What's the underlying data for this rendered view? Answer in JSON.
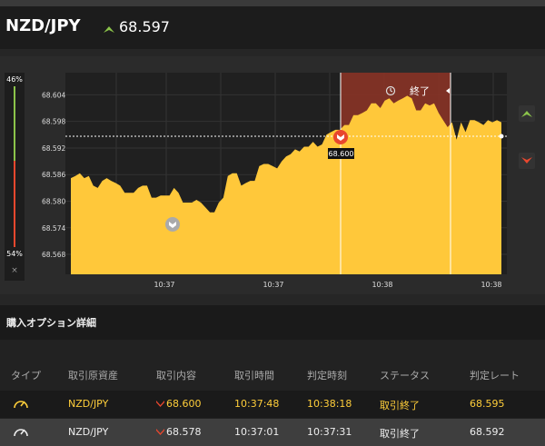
{
  "header": {
    "pair": "NZD/JPY",
    "rate": "68.597",
    "rate_direction_icon": "up-arrow-icon",
    "accent_up": "#8bc34a",
    "accent_down": "#e8472e"
  },
  "gauge": {
    "top_label": "46%",
    "bottom_label": "54%",
    "close_label": "×",
    "up_percent": 46,
    "down_percent": 54
  },
  "chart": {
    "y_ticks": [
      "68.604",
      "68.598",
      "68.592",
      "68.586",
      "68.580",
      "68.574",
      "68.568"
    ],
    "x_ticks": [
      "10:37",
      "10:37",
      "10:38",
      "10:38"
    ],
    "current_rate": 68.597,
    "entry_marker_label": "68.600",
    "expiry_label": "終了",
    "area_color": "#ffc83a"
  },
  "chart_data": {
    "type": "area",
    "ylim": [
      68.5635,
      68.609
    ],
    "y": [
      68.5852,
      68.5857,
      68.5863,
      68.5852,
      68.5857,
      68.5835,
      68.583,
      68.5846,
      68.5852,
      68.5846,
      68.5841,
      68.5835,
      68.5819,
      68.5819,
      68.5819,
      68.583,
      68.5835,
      68.5835,
      68.5808,
      68.5808,
      68.5813,
      68.5813,
      68.5813,
      68.583,
      68.5819,
      68.5797,
      68.5797,
      68.5797,
      68.5803,
      68.5797,
      68.5786,
      68.5775,
      68.5775,
      68.5797,
      68.5808,
      68.5857,
      68.5863,
      68.5863,
      68.5835,
      68.5841,
      68.5846,
      68.5846,
      68.5879,
      68.5884,
      68.5884,
      68.5879,
      68.5874,
      68.589,
      68.5901,
      68.5906,
      68.5917,
      68.5912,
      68.5923,
      68.5923,
      68.5934,
      68.5923,
      68.5928,
      68.595,
      68.5956,
      68.5961,
      68.5961,
      68.5972,
      68.5972,
      68.5994,
      68.5994,
      68.5999,
      68.6005,
      68.6021,
      68.6021,
      68.601,
      68.6027,
      68.6032,
      68.6021,
      68.6027,
      68.6032,
      68.6038,
      68.6032,
      68.6005,
      68.6005,
      68.6021,
      68.6016,
      68.6021,
      68.5999,
      68.5983,
      68.5967,
      68.5978,
      68.5939,
      68.5978,
      68.5956,
      68.5983,
      68.5983,
      68.5978,
      68.5972,
      68.5983,
      68.5978,
      68.5983,
      68.5978
    ],
    "events": [
      {
        "type": "down",
        "rate": 68.5755,
        "label": ""
      },
      {
        "type": "down",
        "rate": 68.5978,
        "label": "68.600"
      }
    ]
  },
  "section": {
    "title": "購入オプション詳細"
  },
  "table": {
    "headers": [
      "タイプ",
      "取引原資産",
      "取引内容",
      "取引時間",
      "判定時刻",
      "ステータス",
      "判定レート"
    ],
    "rows": [
      {
        "type_icon": "timer-icon",
        "asset": "NZD/JPY",
        "direction_icon": "down-arrow-icon",
        "price": "68.600",
        "trade_time": "10:37:48",
        "judge_time": "10:38:18",
        "status": "取引終了",
        "judge_rate": "68.595"
      },
      {
        "type_icon": "timer-icon",
        "asset": "NZD/JPY",
        "direction_icon": "down-arrow-icon",
        "price": "68.578",
        "trade_time": "10:37:01",
        "judge_time": "10:37:31",
        "status": "取引終了",
        "judge_rate": "68.592"
      }
    ]
  }
}
